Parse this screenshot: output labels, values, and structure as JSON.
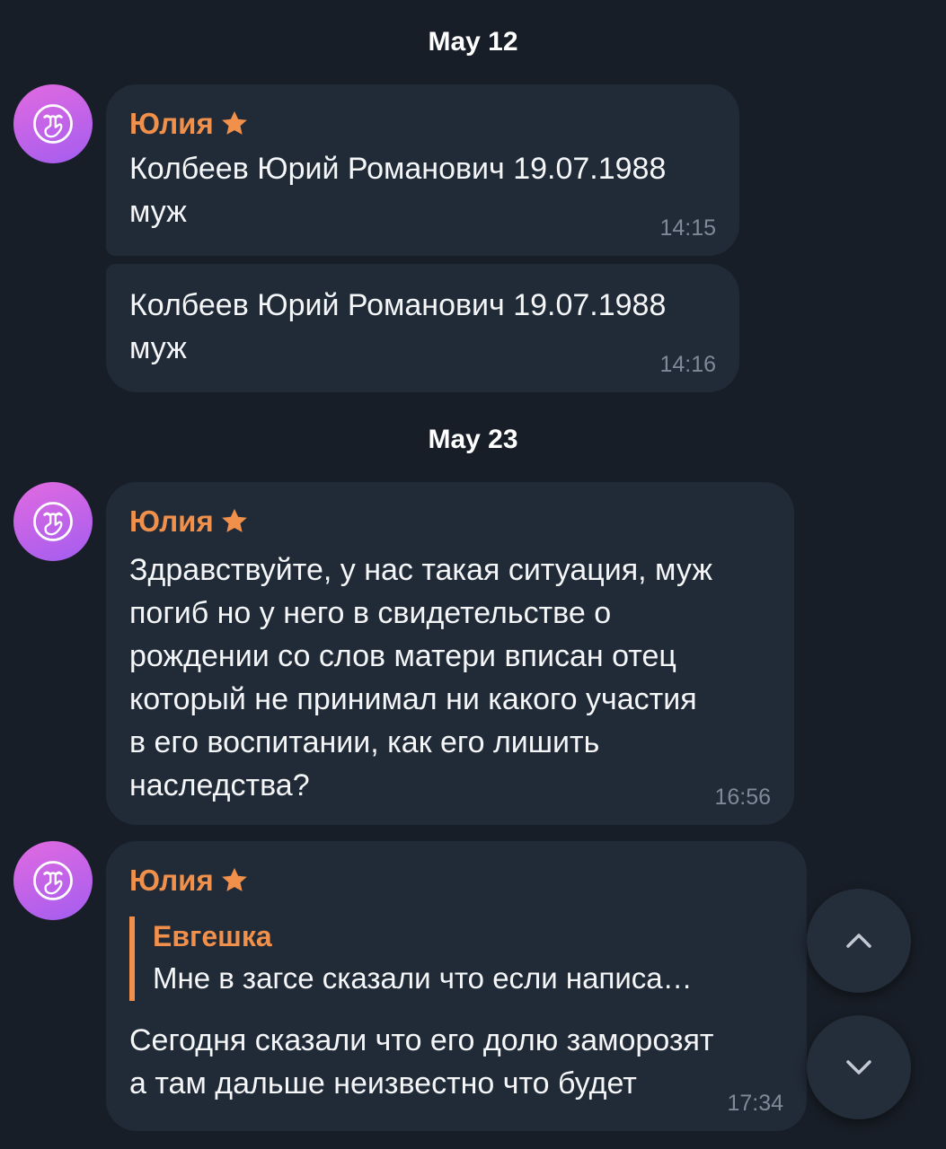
{
  "dates": {
    "first": "May 12",
    "second": "May 23"
  },
  "messages": [
    {
      "sender": "Юлия",
      "text": "Колбеев Юрий Романович 19.07.1988\nмуж",
      "time": "14:15"
    },
    {
      "text": "Колбеев Юрий Романович 19.07.1988\nмуж",
      "time": "14:16"
    },
    {
      "sender": "Юлия",
      "text": "Здравствуйте, у нас такая ситуация, муж\nпогиб но у него в свидетельстве о\nрождении со слов матери вписан отец\nкоторый не принимал ни какого участия\nв его воспитании, как его лишить\nнаследства?",
      "time": "16:56"
    },
    {
      "sender": "Юлия",
      "reply": {
        "name": "Евгешка",
        "text": "Мне в загсе сказали что если написа…"
      },
      "text": "Сегодня сказали что его долю заморозят\nа там дальше неизвестно что будет",
      "time": "17:34"
    }
  ],
  "icons": {
    "avatar": "shush-face-icon",
    "sender_badge": "star-icon",
    "scroll_up": "chevron-up-icon",
    "scroll_down": "chevron-down-icon"
  },
  "colors": {
    "background": "#181e27",
    "bubble": "#212a37",
    "accent": "#f0904a",
    "timestamp": "#7f8a99"
  }
}
